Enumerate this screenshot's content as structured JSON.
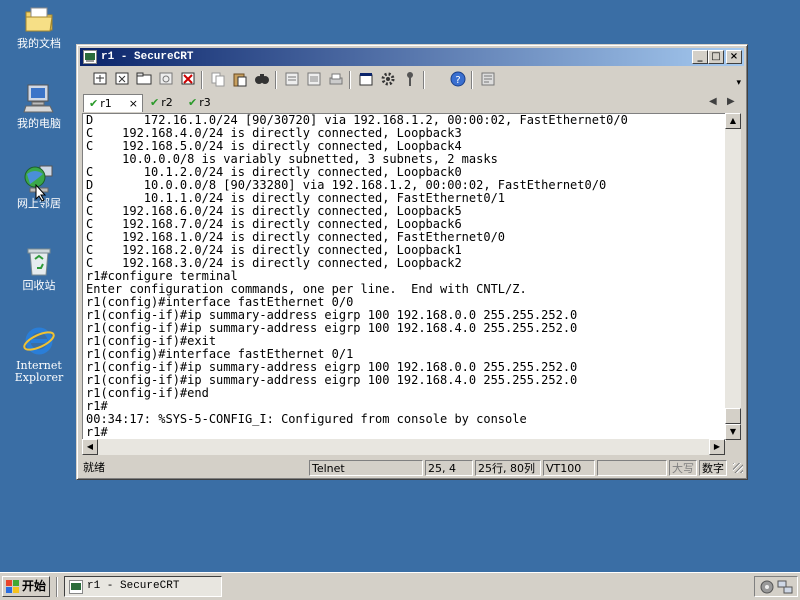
{
  "desktop": {
    "icons": [
      {
        "label": "我的文档"
      },
      {
        "label": "我的电脑"
      },
      {
        "label": "网上邻居"
      },
      {
        "label": "回收站"
      },
      {
        "label_line1": "Internet",
        "label_line2": "Explorer"
      }
    ]
  },
  "window": {
    "title": "r1 - SecureCRT",
    "buttons": {
      "minimize": "_",
      "maximize": "□",
      "close": "×"
    }
  },
  "tabs": [
    {
      "label": "r1",
      "close": "×",
      "active": true
    },
    {
      "label": "r2"
    },
    {
      "label": "r3"
    }
  ],
  "tab_nav": {
    "prev": "◀",
    "next": "▶"
  },
  "terminal": {
    "lines": [
      "D       172.16.1.0/24 [90/30720] via 192.168.1.2, 00:00:02, FastEthernet0/0",
      "C    192.168.4.0/24 is directly connected, Loopback3",
      "C    192.168.5.0/24 is directly connected, Loopback4",
      "     10.0.0.0/8 is variably subnetted, 3 subnets, 2 masks",
      "C       10.1.2.0/24 is directly connected, Loopback0",
      "D       10.0.0.0/8 [90/33280] via 192.168.1.2, 00:00:02, FastEthernet0/0",
      "C       10.1.1.0/24 is directly connected, FastEthernet0/1",
      "C    192.168.6.0/24 is directly connected, Loopback5",
      "C    192.168.7.0/24 is directly connected, Loopback6",
      "C    192.168.1.0/24 is directly connected, FastEthernet0/0",
      "C    192.168.2.0/24 is directly connected, Loopback1",
      "C    192.168.3.0/24 is directly connected, Loopback2",
      "r1#configure terminal",
      "Enter configuration commands, one per line.  End with CNTL/Z.",
      "r1(config)#interface fastEthernet 0/0",
      "r1(config-if)#ip summary-address eigrp 100 192.168.0.0 255.255.252.0",
      "r1(config-if)#ip summary-address eigrp 100 192.168.4.0 255.255.252.0",
      "r1(config-if)#exit",
      "r1(config)#interface fastEthernet 0/1",
      "r1(config-if)#ip summary-address eigrp 100 192.168.0.0 255.255.252.0",
      "r1(config-if)#ip summary-address eigrp 100 192.168.4.0 255.255.252.0",
      "r1(config-if)#end",
      "r1#",
      "00:34:17: %SYS-5-CONFIG_I: Configured from console by console",
      "r1#"
    ]
  },
  "statusbar": {
    "ready": "就绪",
    "protocol": "Telnet",
    "cursor": "25,  4",
    "size": "25行, 80列",
    "emulation": "VT100",
    "caps": "大写",
    "num": "数字"
  },
  "taskbar": {
    "start_label": "开始",
    "task_label": "r1 - SecureCRT"
  },
  "colors": {
    "desktop": "#3a6ea5",
    "titlebar_start": "#0a246a",
    "titlebar_end": "#a6caf0",
    "chrome": "#d4d0c8"
  }
}
